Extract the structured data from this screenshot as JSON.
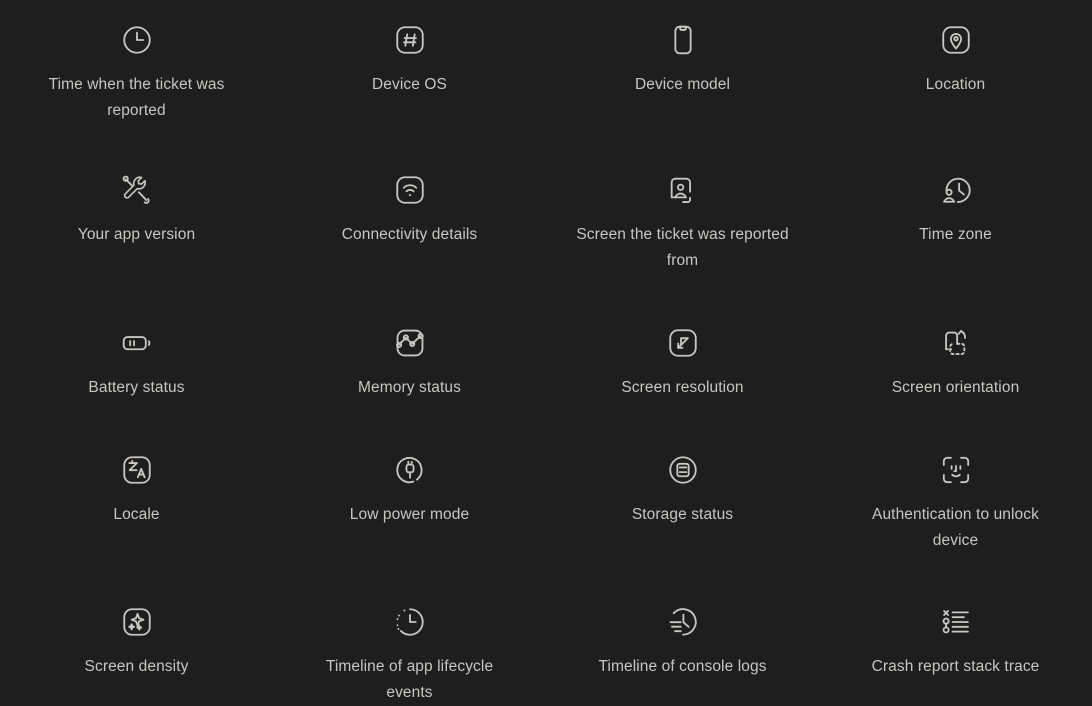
{
  "theme": {
    "background": "#1e1e1e",
    "text_color": "#c9c6c2",
    "icon_color": "#c9c6c2"
  },
  "grid": {
    "columns": 4,
    "rows": 5,
    "items": [
      {
        "label": "Time when the ticket was reported",
        "icon": "clock-icon"
      },
      {
        "label": "Device OS",
        "icon": "hash-square-icon"
      },
      {
        "label": "Device model",
        "icon": "phone-icon"
      },
      {
        "label": "Location",
        "icon": "location-pin-square-icon"
      },
      {
        "label": "Your app version",
        "icon": "tools-icon"
      },
      {
        "label": "Connectivity details",
        "icon": "wifi-square-icon"
      },
      {
        "label": "Screen the ticket was reported from",
        "icon": "user-screen-icon"
      },
      {
        "label": "Time zone",
        "icon": "user-clock-icon"
      },
      {
        "label": "Battery status",
        "icon": "battery-icon"
      },
      {
        "label": "Memory status",
        "icon": "chart-square-icon"
      },
      {
        "label": "Screen resolution",
        "icon": "expand-square-icon"
      },
      {
        "label": "Screen orientation",
        "icon": "rotate-device-icon"
      },
      {
        "label": "Locale",
        "icon": "translate-square-icon"
      },
      {
        "label": "Low power mode",
        "icon": "low-power-plug-icon"
      },
      {
        "label": "Storage status",
        "icon": "storage-circle-icon"
      },
      {
        "label": "Authentication to unlock device",
        "icon": "face-id-icon"
      },
      {
        "label": "Screen density",
        "icon": "sparkle-square-icon"
      },
      {
        "label": "Timeline of app lifecycle events",
        "icon": "clock-dotted-icon"
      },
      {
        "label": "Timeline of console logs",
        "icon": "clock-lines-icon"
      },
      {
        "label": "Crash report stack trace",
        "icon": "stack-trace-icon"
      }
    ]
  }
}
